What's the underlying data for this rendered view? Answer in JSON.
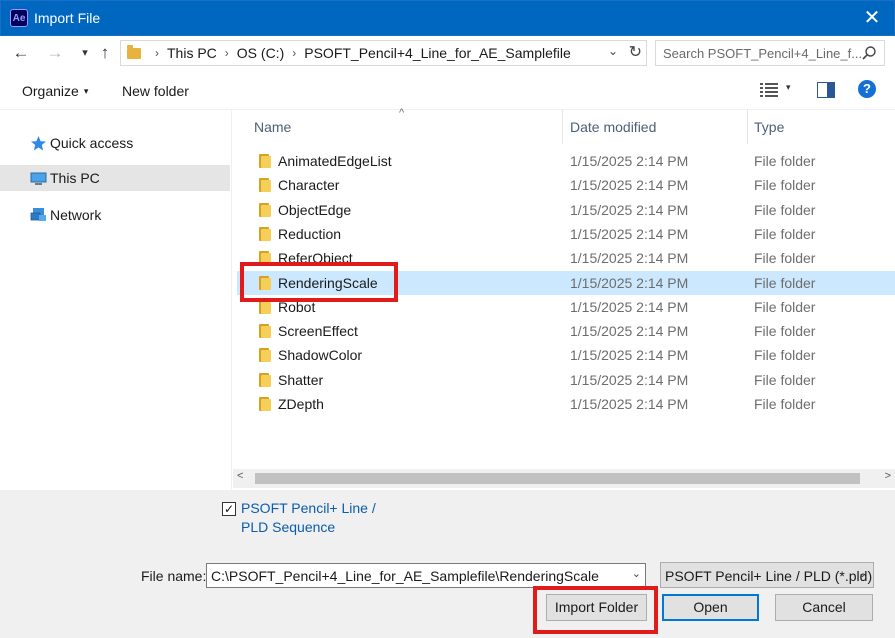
{
  "window": {
    "title": "Import File",
    "app_icon_text": "Ae",
    "close_glyph": "✕"
  },
  "navigation": {
    "back_glyph": "←",
    "forward_glyph": "→",
    "recent_glyph": "▾",
    "up_glyph": "↑",
    "breadcrumbs": [
      "This PC",
      "OS (C:)",
      "PSOFT_Pencil+4_Line_for_AE_Samplefile"
    ],
    "crumb_separator": "›",
    "address_dropdown_glyph": "⌄",
    "refresh_glyph": "↻",
    "search_placeholder": "Search PSOFT_Pencil+4_Line_f..."
  },
  "toolbar": {
    "organize_label": "Organize",
    "caret": "▾",
    "new_folder_label": "New folder",
    "help_glyph": "?"
  },
  "sidebar": {
    "items": [
      {
        "label": "Quick access",
        "icon": "star-icon",
        "selected": false
      },
      {
        "label": "This PC",
        "icon": "computer-icon",
        "selected": true
      },
      {
        "label": "Network",
        "icon": "network-icon",
        "selected": false
      }
    ]
  },
  "file_list": {
    "columns": [
      "Name",
      "Date modified",
      "Type"
    ],
    "sort_indicator": "^",
    "rows": [
      {
        "name": "AnimatedEdgeList",
        "date": "1/15/2025 2:14 PM",
        "type": "File folder"
      },
      {
        "name": "Character",
        "date": "1/15/2025 2:14 PM",
        "type": "File folder"
      },
      {
        "name": "ObjectEdge",
        "date": "1/15/2025 2:14 PM",
        "type": "File folder"
      },
      {
        "name": "Reduction",
        "date": "1/15/2025 2:14 PM",
        "type": "File folder"
      },
      {
        "name": "ReferObject",
        "date": "1/15/2025 2:14 PM",
        "type": "File folder"
      },
      {
        "name": "RenderingScale",
        "date": "1/15/2025 2:14 PM",
        "type": "File folder",
        "selected": true
      },
      {
        "name": "Robot",
        "date": "1/15/2025 2:14 PM",
        "type": "File folder"
      },
      {
        "name": "ScreenEffect",
        "date": "1/15/2025 2:14 PM",
        "type": "File folder"
      },
      {
        "name": "ShadowColor",
        "date": "1/15/2025 2:14 PM",
        "type": "File folder"
      },
      {
        "name": "Shatter",
        "date": "1/15/2025 2:14 PM",
        "type": "File folder"
      },
      {
        "name": "ZDepth",
        "date": "1/15/2025 2:14 PM",
        "type": "File folder"
      }
    ],
    "scroll_left_glyph": "<",
    "scroll_right_glyph": ">"
  },
  "footer": {
    "sequence_checkbox_checked": true,
    "check_glyph": "✓",
    "sequence_label": "PSOFT Pencil+ Line / PLD Sequence",
    "file_name_label": "File name:",
    "file_name_value": "C:\\PSOFT_Pencil+4_Line_for_AE_Samplefile\\RenderingScale",
    "dropdown_glyph": "⌄",
    "file_type_filter": "PSOFT Pencil+ Line / PLD (*.pld)",
    "import_folder_label": "Import Folder",
    "open_label": "Open",
    "cancel_label": "Cancel"
  },
  "colors": {
    "titlebar": "#0067c0",
    "selection": "#cce8ff",
    "highlight_box": "#e01b1b",
    "folder": "#f6cf58"
  }
}
